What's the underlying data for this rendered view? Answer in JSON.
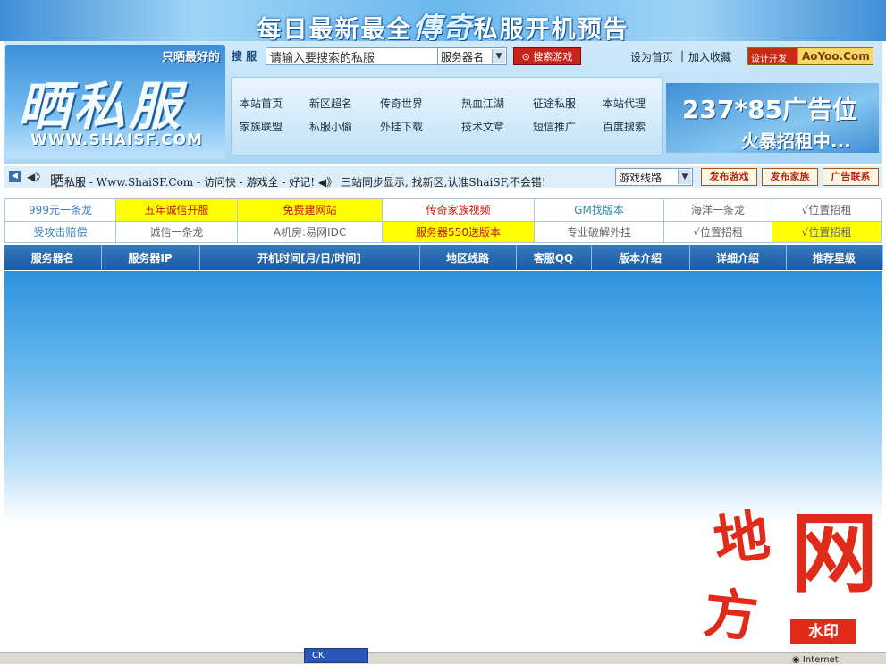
{
  "banner": {
    "pre": "每日最新最全",
    "mid": "傳奇",
    "post": "私服开机预告"
  },
  "logo": {
    "slogan": "只晒最好的",
    "name": "晒私服",
    "url": "WWW.SHAISF.COM"
  },
  "search": {
    "label": "搜 服",
    "placeholder": "请输入要搜索的私服",
    "select_value": "服务器名",
    "button": "搜索游戏"
  },
  "top_links": {
    "set_home": "设为首页",
    "sep": "|",
    "favorite": "加入收藏"
  },
  "design_ad": {
    "label": "设计开发",
    "brand": "AoYoo.Com"
  },
  "nav": {
    "row1": [
      "本站首页",
      "新区超名",
      "传奇世界",
      "热血江湖",
      "征途私服",
      "本站代理"
    ],
    "row2": [
      "家族联盟",
      "私服小偷",
      "外挂下载",
      "技术文章",
      "短信推广",
      "百度搜索"
    ]
  },
  "ad_slot": {
    "line1": "237*85广告位",
    "line2": "火暴招租中..."
  },
  "ticker": {
    "sound": "◀》",
    "big": "晒",
    "text": "私服 - Www.ShaiSF.Com - 访问快 - 游戏全 - 好记!",
    "sound2": "◀》",
    "text2": "三站同步显示, 找新区,认准ShaiSF,不会错!",
    "route_select": "游戏线路",
    "buttons": [
      "发布游戏",
      "发布家族",
      "广告联系"
    ]
  },
  "ads": [
    [
      "999元一条龙",
      "五年诚信开服",
      "免费建网站",
      "传奇家族视频",
      "GM找版本",
      "海洋一条龙",
      "√位置招租"
    ],
    [
      "受攻击赔偿",
      "诚信一条龙",
      "A机房:易网IDC",
      "服务器550送版本",
      "专业破解外挂",
      "√位置招租",
      "√位置招租"
    ]
  ],
  "columns": [
    "服务器名",
    "服务器IP",
    "开机时间[月/日/时间]",
    "地区线路",
    "客服QQ",
    "版本介绍",
    "详细介绍",
    "推荐星级"
  ],
  "taskbar": {
    "task": "CK",
    "tray": "Internet"
  },
  "watermark": {
    "a": "地",
    "b": "方",
    "c": "网",
    "badge": "水印"
  }
}
